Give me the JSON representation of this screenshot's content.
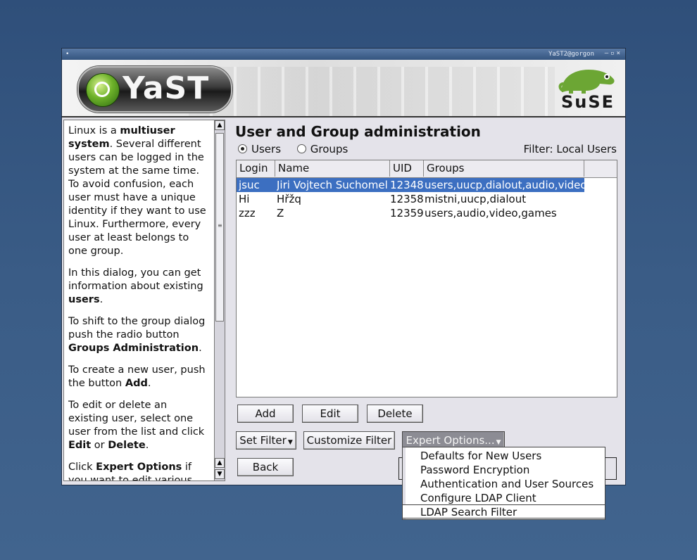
{
  "window": {
    "title": "YaST2@gorgon",
    "menu_dot": "•",
    "controls": "–▫×"
  },
  "banner": {
    "yast_logo_text": "YaST",
    "suse_logo_text": "SuSE"
  },
  "help": {
    "paragraphs": [
      "Linux is a <b>multiuser system</b>. Several different users can be logged in the system at the same time. To avoid confusion, each user must have a unique identity if they want to use Linux. Furthermore, every user at least belongs to one group.",
      "In this dialog, you can get information about existing <b>users</b>.",
      "To shift to the group dialog push the radio button <b>Groups Administration</b>.",
      "To create a new user, push the button <b>Add</b>.",
      "To edit or delete an existing user, select one user from the list and click <b>Edit</b> or <b>Delete</b>.",
      "Click <b>Expert Options</b> if you want to edit various"
    ]
  },
  "main": {
    "heading": "User and Group administration",
    "radio_users": "Users",
    "radio_groups": "Groups",
    "filter_label": "Filter: Local Users"
  },
  "table": {
    "columns": [
      "Login",
      "Name",
      "UID",
      "Groups"
    ],
    "rows": [
      {
        "login": "jsuc",
        "name": "Jiri Vojtech Suchomel",
        "uid": "12348",
        "groups": "users,uucp,dialout,audio,video",
        "selected": true
      },
      {
        "login": "Hi",
        "name": "Hřžq",
        "uid": "12358",
        "groups": "mistni,uucp,dialout",
        "selected": false
      },
      {
        "login": "zzz",
        "name": "Z",
        "uid": "12359",
        "groups": "users,audio,video,games",
        "selected": false
      }
    ]
  },
  "buttons": {
    "add": "Add",
    "edit": "Edit",
    "delete": "Delete",
    "set_filter": "Set Filter",
    "customize_filter": "Customize Filter",
    "expert_options": "Expert Options...",
    "back": "Back"
  },
  "expert_menu": {
    "items": [
      "Defaults for New Users",
      "Password Encryption",
      "Authentication and User Sources",
      "Configure LDAP Client",
      "LDAP Search Filter"
    ]
  },
  "colors": {
    "selection": "#3c6fc1",
    "desktop": "#3a5c86",
    "dialog_bg": "#e4e3ea"
  }
}
